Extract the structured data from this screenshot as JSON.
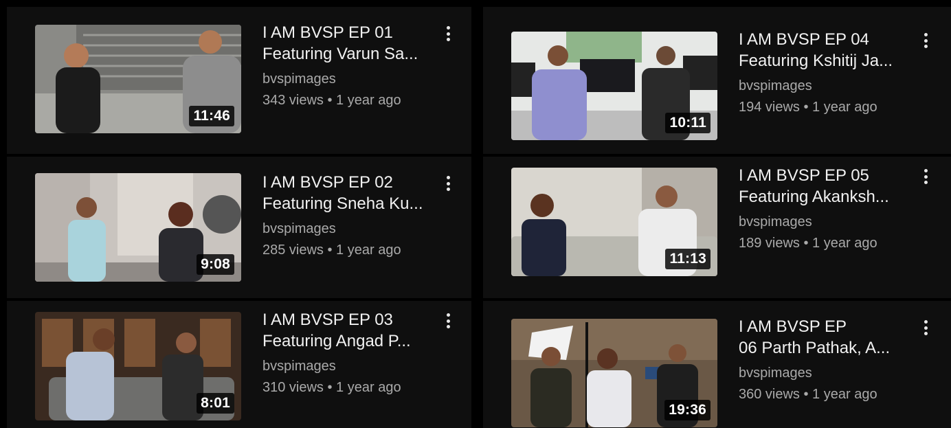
{
  "videos": [
    {
      "title_line1": "I AM BVSP  EP 01",
      "title_line2": "Featuring Varun Sa...",
      "channel": "bvspimages",
      "stats": "343 views • 1 year ago",
      "duration": "11:46"
    },
    {
      "title_line1": "I AM BVSP EP 02",
      "title_line2": "Featuring Sneha Ku...",
      "channel": "bvspimages",
      "stats": "285 views • 1 year ago",
      "duration": "9:08"
    },
    {
      "title_line1": "I AM BVSP EP 03",
      "title_line2": "Featuring Angad P...",
      "channel": "bvspimages",
      "stats": "310 views • 1 year ago",
      "duration": "8:01"
    },
    {
      "title_line1": "I AM BVSP EP 04",
      "title_line2": "Featuring Kshitij Ja...",
      "channel": "bvspimages",
      "stats": "194 views • 1 year ago",
      "duration": "10:11"
    },
    {
      "title_line1": "I AM BVSP EP 05",
      "title_line2": "Featuring Akanksh...",
      "channel": "bvspimages",
      "stats": "189 views • 1 year ago",
      "duration": "11:13"
    },
    {
      "title_line1": "I AM BVSP EP",
      "title_line2": "06 Parth Pathak, A...",
      "channel": "bvspimages",
      "stats": "360 views • 1 year ago",
      "duration": "19:36"
    }
  ],
  "icons": {
    "more": "more-vertical-icon"
  }
}
